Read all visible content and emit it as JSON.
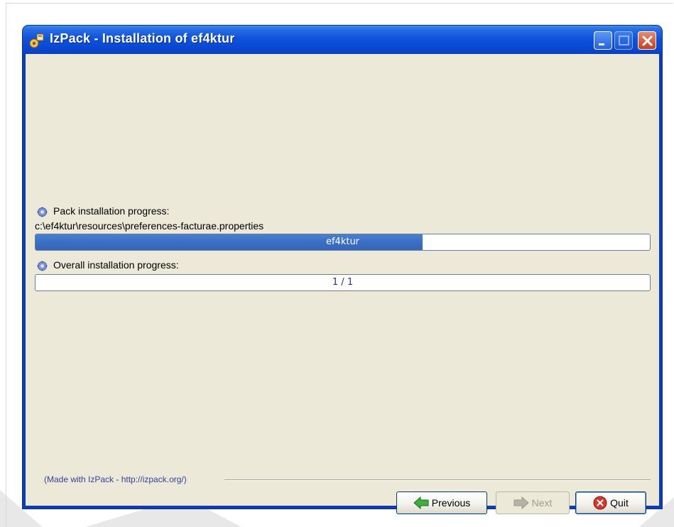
{
  "window": {
    "title": "IzPack - Installation of ef4ktur"
  },
  "pack_progress": {
    "label": "Pack installation progress:",
    "current_file": "c:\\ef4ktur\\resources\\preferences-facturae.properties",
    "bar_text": "ef4ktur",
    "fraction": 0.63
  },
  "overall_progress": {
    "label": "Overall installation progress:",
    "bar_text": "1 / 1",
    "fraction": 0.0
  },
  "footer": {
    "made_with": "(Made with IzPack - http://izpack.org/)"
  },
  "buttons": {
    "previous_label": "Previous",
    "next_label": "Next",
    "quit_label": "Quit"
  },
  "colors": {
    "title_bar": "#0a49d4",
    "client_bg": "#ece9d8",
    "progress_fill": "#3b6ec4",
    "footer_text": "#33429a"
  },
  "icons": {
    "app": "installer-icon",
    "gear": "gear-icon",
    "previous": "green-left-arrow-icon",
    "next": "gray-right-arrow-icon",
    "quit": "red-x-circle-icon"
  }
}
